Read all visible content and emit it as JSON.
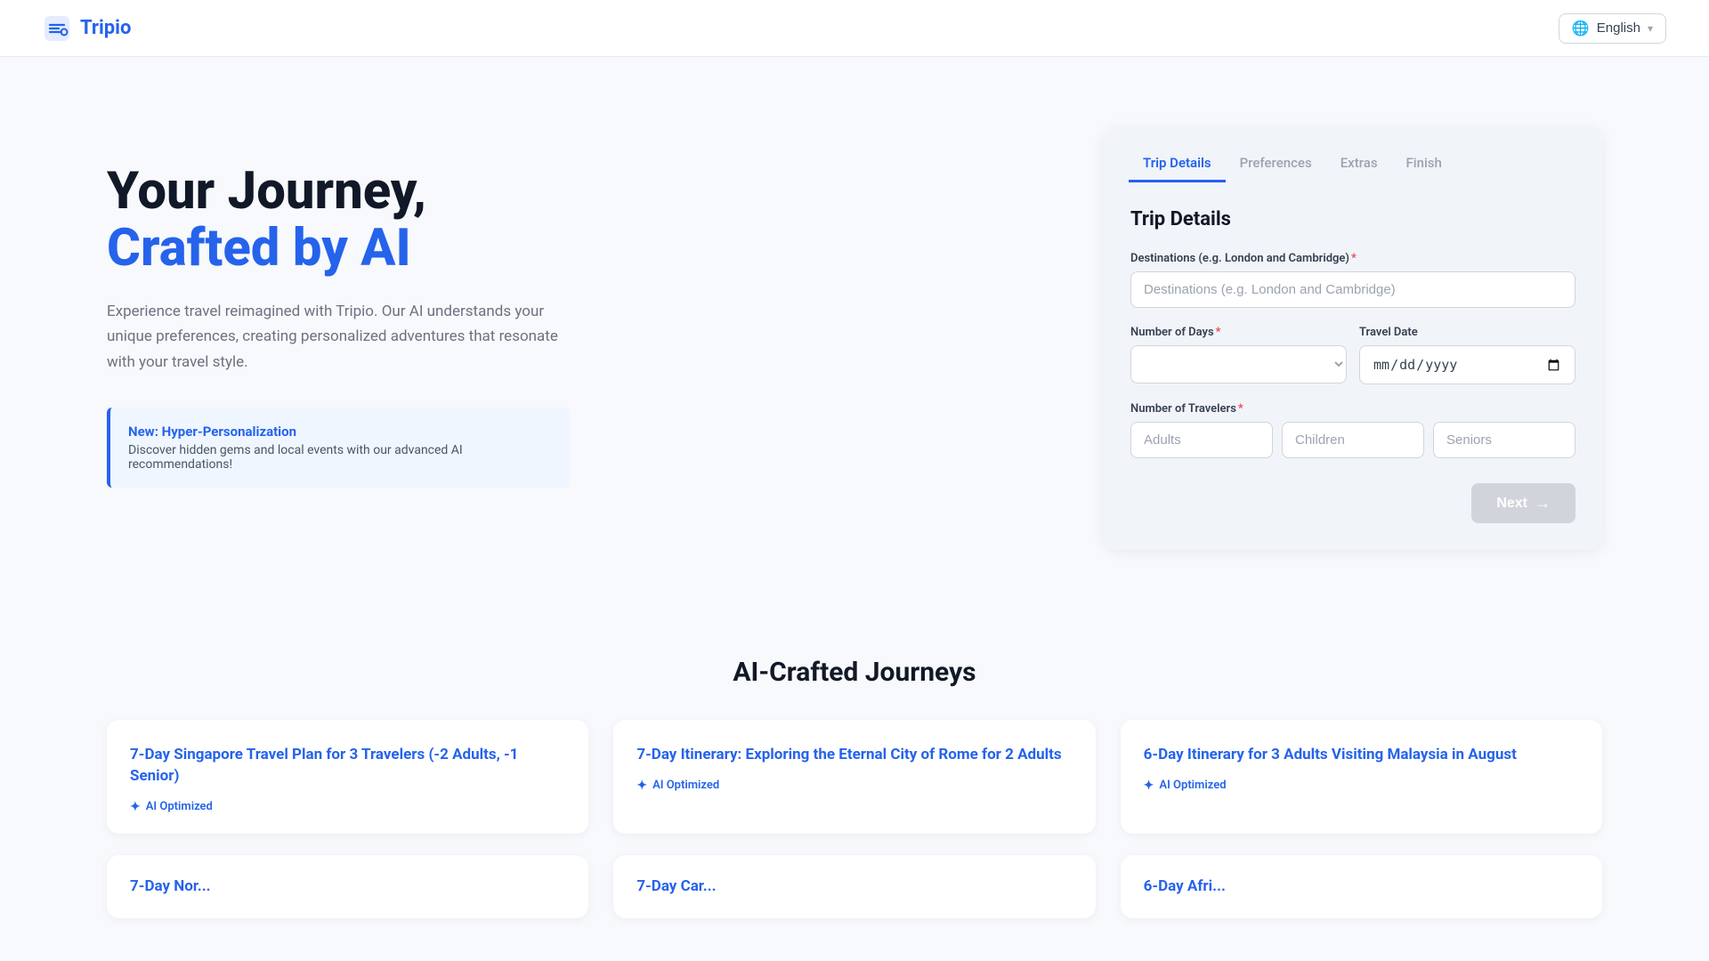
{
  "header": {
    "logo_text": "Tripio",
    "language_label": "English"
  },
  "hero": {
    "title_line1": "Your Journey,",
    "title_line2": "Crafted by AI",
    "description": "Experience travel reimagined with Tripio. Our AI understands your unique preferences, creating personalized adventures that resonate with your travel style.",
    "callout_title": "New: Hyper-Personalization",
    "callout_desc": "Discover hidden gems and local events with our advanced AI recommendations!"
  },
  "form": {
    "section_title": "Trip Details",
    "tabs": [
      {
        "label": "Trip Details",
        "active": true
      },
      {
        "label": "Preferences",
        "active": false
      },
      {
        "label": "Extras",
        "active": false
      },
      {
        "label": "Finish",
        "active": false
      }
    ],
    "destinations_label": "Destinations (e.g. London and Cambridge)",
    "destinations_placeholder": "Destinations (e.g. London and Cambridge)",
    "days_label": "Number of Days",
    "travel_date_label": "Travel Date",
    "travel_date_placeholder": "mm/dd/yyyy",
    "travelers_label": "Number of Travelers",
    "adults_placeholder": "Adults",
    "children_placeholder": "Children",
    "seniors_placeholder": "Seniors",
    "next_label": "Next",
    "next_arrow": "→"
  },
  "journeys": {
    "section_title": "AI-Crafted Journeys",
    "cards": [
      {
        "title": "7-Day Singapore Travel Plan for 3 Travelers (-2 Adults, -1 Senior)",
        "badge": "AI Optimized"
      },
      {
        "title": "7-Day Itinerary: Exploring the Eternal City of Rome for 2 Adults",
        "badge": "AI Optimized"
      },
      {
        "title": "6-Day Itinerary for 3 Adults Visiting Malaysia in August",
        "badge": "AI Optimized"
      }
    ],
    "partial_cards": [
      {
        "title": "7-Day Nor..."
      },
      {
        "title": "7-Day Car..."
      },
      {
        "title": "6-Day Afri..."
      }
    ]
  }
}
